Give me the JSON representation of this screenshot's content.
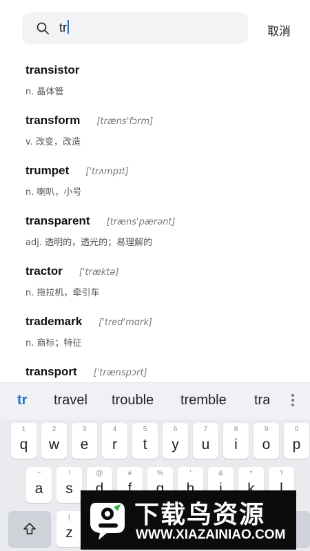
{
  "search": {
    "query": "tr",
    "cancel_label": "取消"
  },
  "results": [
    {
      "word": "transistor",
      "phonetic": "",
      "definition": "n. 晶体管"
    },
    {
      "word": "transform",
      "phonetic": "[træns'fɔrm]",
      "definition": "v. 改变，改造"
    },
    {
      "word": "trumpet",
      "phonetic": "['trʌmpɪt]",
      "definition": "n. 喇叭，小号"
    },
    {
      "word": "transparent",
      "phonetic": "[træns'pærənt]",
      "definition": "adj. 透明的，透光的；易理解的"
    },
    {
      "word": "tractor",
      "phonetic": "['træktə]",
      "definition": "n. 拖拉机，牵引车"
    },
    {
      "word": "trademark",
      "phonetic": "['tred'mɑrk]",
      "definition": "n. 商标；特征"
    },
    {
      "word": "transport",
      "phonetic": "['trænspɔrt]",
      "definition": ""
    }
  ],
  "suggestions": [
    "tr",
    "travel",
    "trouble",
    "tremble",
    "tra"
  ],
  "keyboard": {
    "row1": [
      {
        "hint": "1",
        "key": "q"
      },
      {
        "hint": "2",
        "key": "w"
      },
      {
        "hint": "3",
        "key": "e"
      },
      {
        "hint": "4",
        "key": "r"
      },
      {
        "hint": "5",
        "key": "t"
      },
      {
        "hint": "6",
        "key": "y"
      },
      {
        "hint": "7",
        "key": "u"
      },
      {
        "hint": "8",
        "key": "i"
      },
      {
        "hint": "9",
        "key": "o"
      },
      {
        "hint": "0",
        "key": "p"
      }
    ],
    "row2": [
      {
        "hint": "~",
        "key": "a"
      },
      {
        "hint": "!",
        "key": "s"
      },
      {
        "hint": "@",
        "key": "d"
      },
      {
        "hint": "#",
        "key": "f"
      },
      {
        "hint": "%",
        "key": "g"
      },
      {
        "hint": "'",
        "key": "h"
      },
      {
        "hint": "&",
        "key": "j"
      },
      {
        "hint": "*",
        "key": "k"
      },
      {
        "hint": "?",
        "key": "l"
      }
    ],
    "row3": [
      {
        "hint": "(",
        "key": "z"
      }
    ]
  },
  "watermark": {
    "title": "下载鸟资源",
    "url": "WWW.XIAZAINIAO.COM"
  },
  "colors": {
    "accent": "#1f74c8",
    "search_bg": "#f2f3f5",
    "keyboard_bg": "#e9ebee"
  },
  "icons": {
    "search": "search-icon",
    "shift": "shift-icon",
    "more": "more-vertical-icon"
  }
}
